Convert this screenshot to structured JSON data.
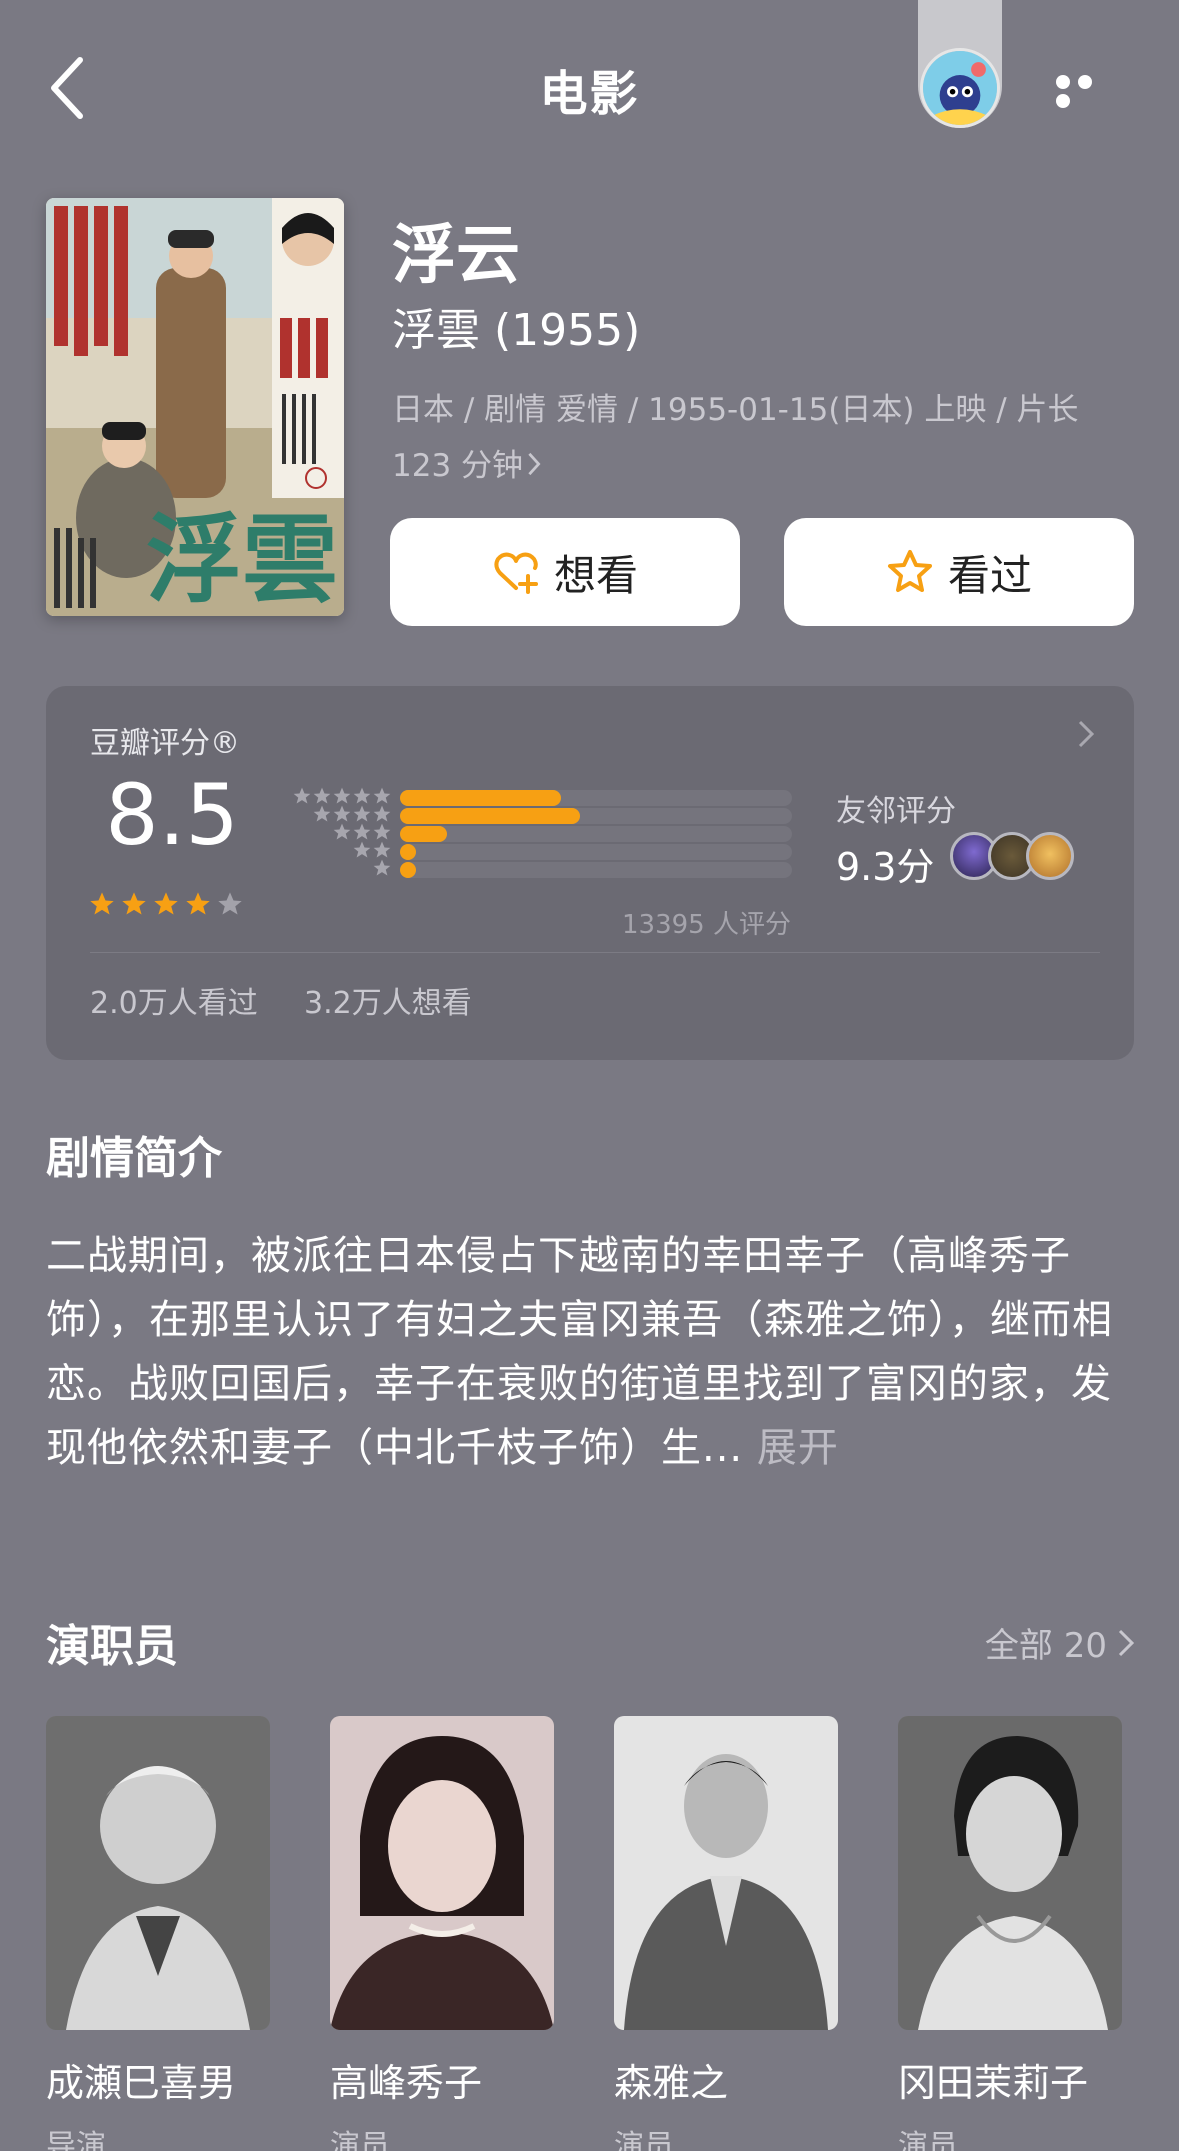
{
  "nav": {
    "title": "电影",
    "back_icon": "chevron-left-icon",
    "more_icon": "more-dots-icon"
  },
  "movie": {
    "title_cn": "浮云",
    "title_original": "浮雲 (1955)",
    "meta_line1": "日本 / 剧情 爱情 / 1955-01-15(日本) 上映 / 片长",
    "meta_line2": "123 分钟",
    "poster_title": "浮雲"
  },
  "actions": {
    "want_label": "想看",
    "seen_label": "看过"
  },
  "rating": {
    "title": "豆瓣评分®",
    "score": "8.5",
    "stars_filled": 4,
    "distribution": [
      0.41,
      0.46,
      0.12,
      0.04,
      0.04
    ],
    "count_text": "13395 人评分",
    "friend_label": "友邻评分",
    "friend_score": "9.3分",
    "watched_text": "2.0万人看过",
    "wish_text": "3.2万人想看",
    "star_color": "#f7a013"
  },
  "synopsis": {
    "title": "剧情简介",
    "text": "二战期间，被派往日本侵占下越南的幸田幸子（高峰秀子饰），在那里认识了有妇之夫富冈兼吾（森雅之饰），继而相恋。战败回国后，幸子在衰败的街道里找到了富冈的家，发现他依然和妻子（中北千枝子饰）生...",
    "expand_label": "展开"
  },
  "cast": {
    "title": "演职员",
    "all_label": "全部 20",
    "members": [
      {
        "name": "成瀬巳喜男",
        "role": "导演"
      },
      {
        "name": "高峰秀子",
        "role": "演员"
      },
      {
        "name": "森雅之",
        "role": "演员"
      },
      {
        "name": "冈田茉莉子",
        "role": "演员"
      }
    ]
  }
}
